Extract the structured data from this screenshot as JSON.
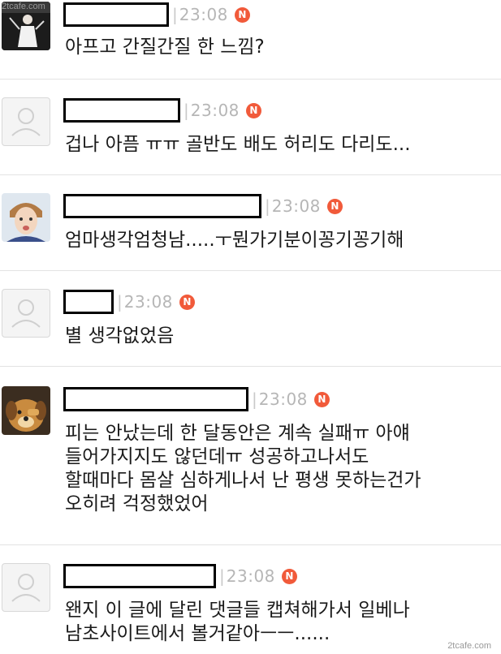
{
  "watermarks": {
    "top_left": "2tcafe.com",
    "bottom_right": "2tcafe.com"
  },
  "badge_label": "N",
  "comments": [
    {
      "avatar": "photo-person-icon",
      "time": "23:08",
      "text": "아프고 간질간질 한 느낌?"
    },
    {
      "avatar": "default-user-icon",
      "time": "23:08",
      "text": "겁나 아픔 ㅠㅠ 골반도 배도 허리도 다리도..."
    },
    {
      "avatar": "photo-face-icon",
      "time": "23:08",
      "text": "엄마생각엄청남.....ㅜ뭔가기분이꽁기꽁기해"
    },
    {
      "avatar": "default-user-icon",
      "time": "23:08",
      "text": "별 생각없었음"
    },
    {
      "avatar": "cartoon-dog-icon",
      "time": "23:08",
      "text": "피는 안났는데 한 달동안은 계속 실패ㅠ 아얘\n들어가지지도 않던데ㅠ 성공하고나서도\n할때마다 몸살 심하게나서 난 평생 못하는건가\n오히려 걱정했었어"
    },
    {
      "avatar": "default-user-icon",
      "time": "23:08",
      "text": "왠지 이 글에 달린 댓글들 캡쳐해가서 일베나\n남초사이트에서 볼거같아ㅡㅡ......"
    }
  ]
}
